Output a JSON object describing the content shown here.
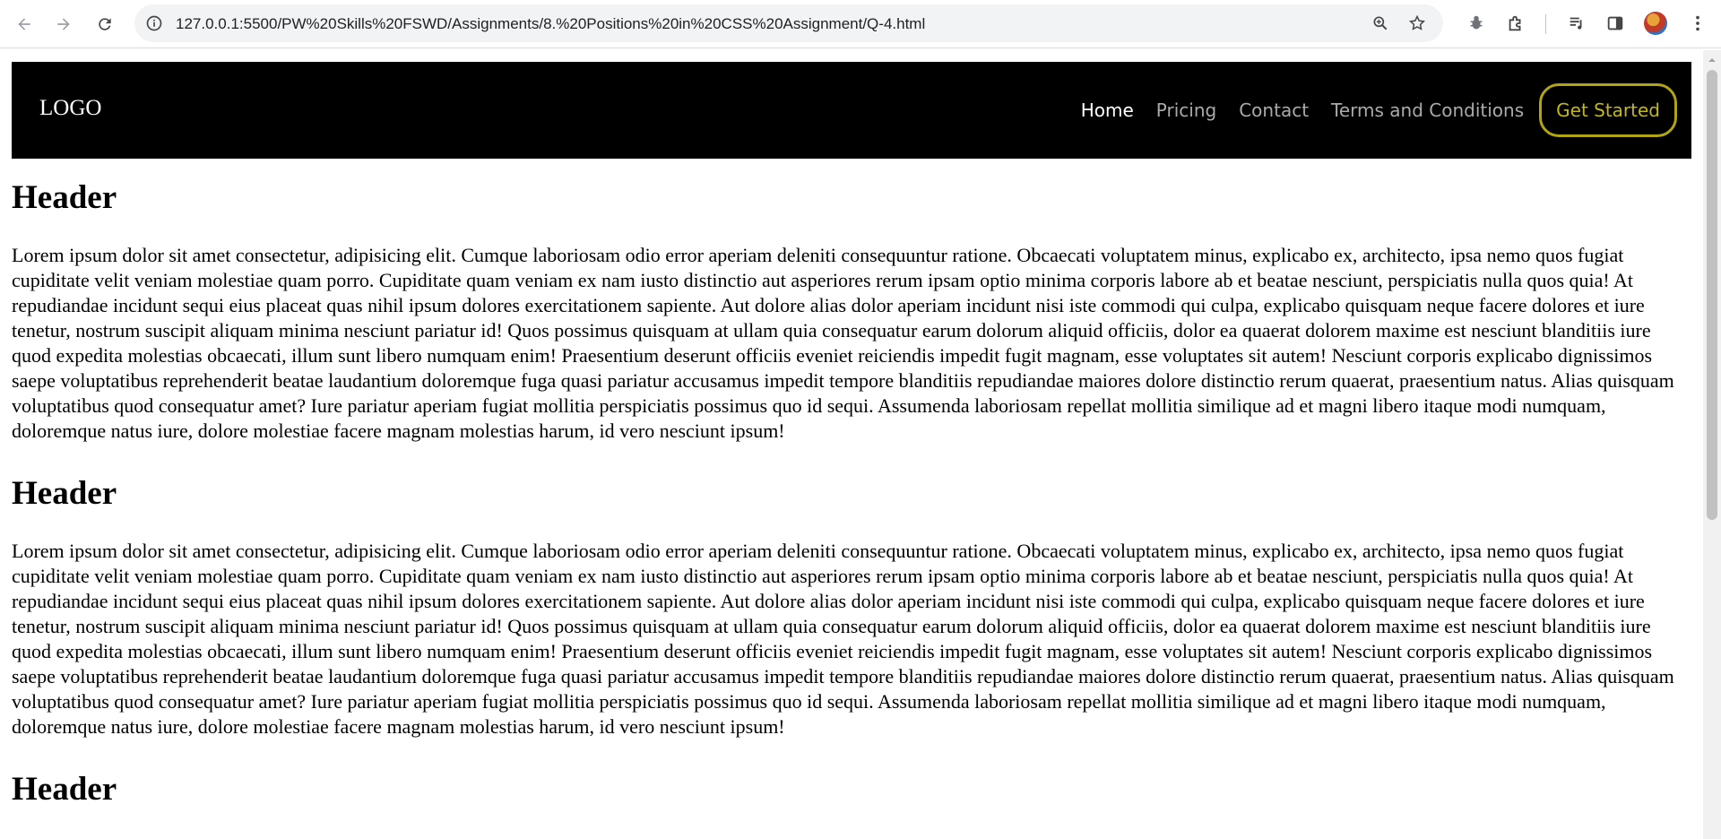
{
  "browser": {
    "url": "127.0.0.1:5500/PW%20Skills%20FSWD/Assignments/8.%20Positions%20in%20CSS%20Assignment/Q-4.html",
    "icons": [
      "back-arrow-icon",
      "forward-arrow-icon",
      "reload-icon",
      "site-info-icon",
      "zoom-icon",
      "star-icon",
      "extension-bug-icon",
      "extensions-puzzle-icon",
      "media-queue-icon",
      "side-panel-icon",
      "profile-avatar",
      "kebab-menu-icon"
    ]
  },
  "site": {
    "logo": "LOGO",
    "menu": [
      {
        "label": "Home",
        "active": true
      },
      {
        "label": "Pricing",
        "active": false
      },
      {
        "label": "Contact",
        "active": false
      },
      {
        "label": "Terms and Conditions",
        "active": false
      }
    ],
    "cta_label": "Get Started",
    "colors": {
      "nav_background": "#000000",
      "menu_active": "#ffffff",
      "menu_inactive": "#aaaaaa",
      "cta": "#c6b719"
    }
  },
  "sections": [
    {
      "title": "Header",
      "text": "Lorem ipsum dolor sit amet consectetur, adipisicing elit. Cumque laboriosam odio error aperiam deleniti consequuntur ratione. Obcaecati voluptatem minus, explicabo ex, architecto, ipsa nemo quos fugiat cupiditate velit veniam molestiae quam porro. Cupiditate quam veniam ex nam iusto distinctio aut asperiores rerum ipsam optio minima corporis labore ab et beatae nesciunt, perspiciatis nulla quos quia! At repudiandae incidunt sequi eius placeat quas nihil ipsum dolores exercitationem sapiente. Aut dolore alias dolor aperiam incidunt nisi iste commodi qui culpa, explicabo quisquam neque facere dolores et iure tenetur, nostrum suscipit aliquam minima nesciunt pariatur id! Quos possimus quisquam at ullam quia consequatur earum dolorum aliquid officiis, dolor ea quaerat dolorem maxime est nesciunt blanditiis iure quod expedita molestias obcaecati, illum sunt libero numquam enim! Praesentium deserunt officiis eveniet reiciendis impedit fugit magnam, esse voluptates sit autem! Nesciunt corporis explicabo dignissimos saepe voluptatibus reprehenderit beatae laudantium doloremque fuga quasi pariatur accusamus impedit tempore blanditiis repudiandae maiores dolore distinctio rerum quaerat, praesentium natus. Alias quisquam voluptatibus quod consequatur amet? Iure pariatur aperiam fugiat mollitia perspiciatis possimus quo id sequi. Assumenda laboriosam repellat mollitia similique ad et magni libero itaque modi numquam, doloremque natus iure, dolore molestiae facere magnam molestias harum, id vero nesciunt ipsum!"
    },
    {
      "title": "Header",
      "text": "Lorem ipsum dolor sit amet consectetur, adipisicing elit. Cumque laboriosam odio error aperiam deleniti consequuntur ratione. Obcaecati voluptatem minus, explicabo ex, architecto, ipsa nemo quos fugiat cupiditate velit veniam molestiae quam porro. Cupiditate quam veniam ex nam iusto distinctio aut asperiores rerum ipsam optio minima corporis labore ab et beatae nesciunt, perspiciatis nulla quos quia! At repudiandae incidunt sequi eius placeat quas nihil ipsum dolores exercitationem sapiente. Aut dolore alias dolor aperiam incidunt nisi iste commodi qui culpa, explicabo quisquam neque facere dolores et iure tenetur, nostrum suscipit aliquam minima nesciunt pariatur id! Quos possimus quisquam at ullam quia consequatur earum dolorum aliquid officiis, dolor ea quaerat dolorem maxime est nesciunt blanditiis iure quod expedita molestias obcaecati, illum sunt libero numquam enim! Praesentium deserunt officiis eveniet reiciendis impedit fugit magnam, esse voluptates sit autem! Nesciunt corporis explicabo dignissimos saepe voluptatibus reprehenderit beatae laudantium doloremque fuga quasi pariatur accusamus impedit tempore blanditiis repudiandae maiores dolore distinctio rerum quaerat, praesentium natus. Alias quisquam voluptatibus quod consequatur amet? Iure pariatur aperiam fugiat mollitia perspiciatis possimus quo id sequi. Assumenda laboriosam repellat mollitia similique ad et magni libero itaque modi numquam, doloremque natus iure, dolore molestiae facere magnam molestias harum, id vero nesciunt ipsum!"
    },
    {
      "title": "Header",
      "text": ""
    }
  ]
}
